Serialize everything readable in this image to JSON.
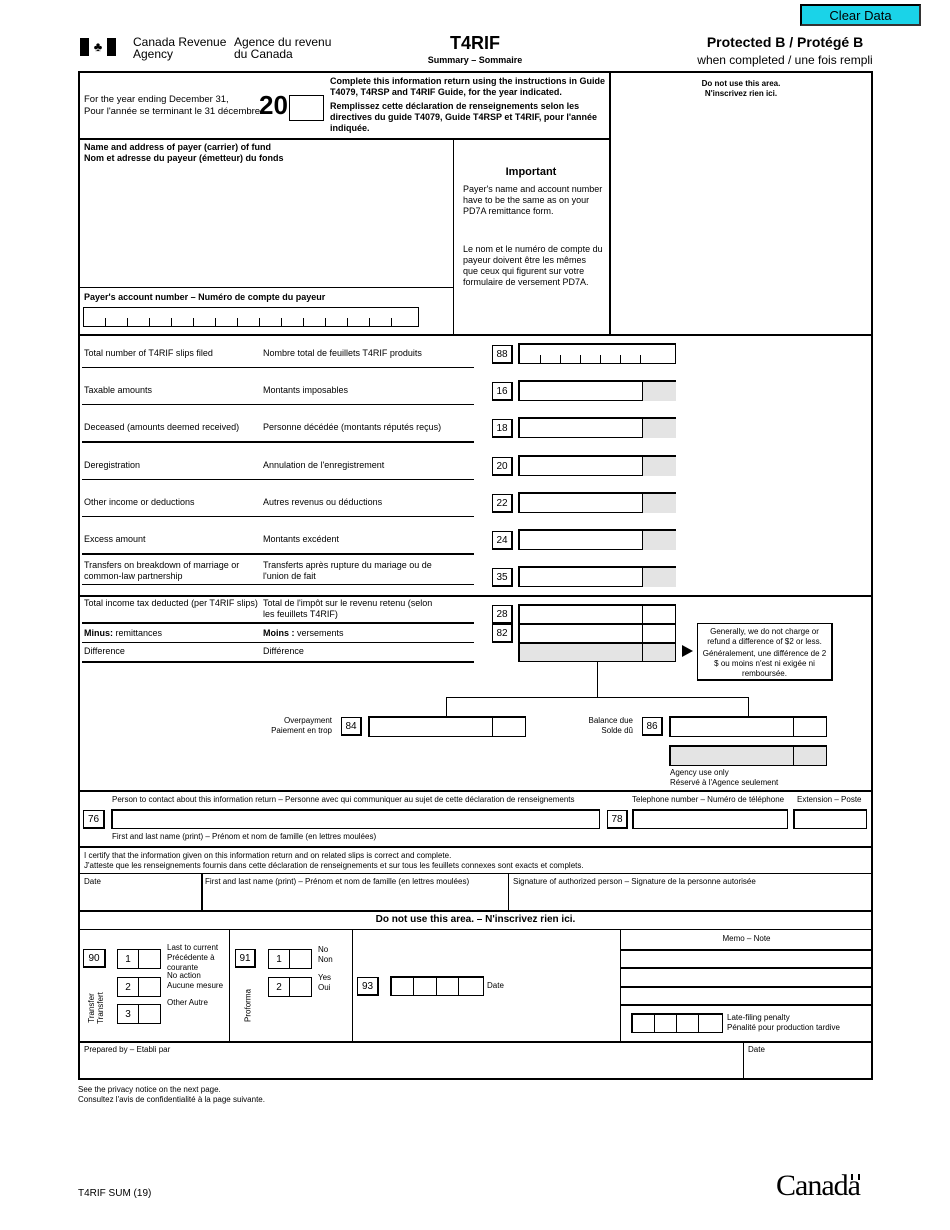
{
  "toolbar": {
    "clear_button": "Clear Data",
    "clear_button_color": "#1ad3e8"
  },
  "header": {
    "agency_en_1": "Canada Revenue",
    "agency_en_2": "Agency",
    "agency_fr_1": "Agence du revenu",
    "agency_fr_2": "du Canada",
    "form_title": "T4RIF",
    "form_subtitle": "Summary – Sommaire",
    "protected": "Protected B / Protégé B",
    "protected_sub": "when completed / une fois rempli"
  },
  "year": {
    "label_en": "For the year ending December 31,",
    "label_fr": "Pour l'année se terminant le 31 décembre",
    "prefix": "20",
    "value": "",
    "instr_en": "Complete this information return using the instructions in Guide T4079, T4RSP and T4RIF Guide, for the year indicated.",
    "instr_fr": "Remplissez cette déclaration de renseignements selon les directives du guide T4079, Guide T4RSP et T4RIF, pour l'année indiquée."
  },
  "do_not_use": {
    "line1": "Do not use this area.",
    "line2": "N'inscrivez rien ici."
  },
  "payer": {
    "label_en": "Name and address of payer (carrier) of fund",
    "label_fr": "Nom et adresse du payeur (émetteur) du fonds",
    "name_address": "",
    "account_label": "Payer's account number – Numéro de compte du payeur",
    "account_value": ""
  },
  "important": {
    "title": "Important",
    "text_en": "Payer's name and account number have to be the same as on your PD7A remittance form.",
    "text_fr": "Le nom et le numéro de compte du payeur doivent être les mêmes que ceux qui figurent sur votre formulaire de versement PD7A."
  },
  "lines": [
    {
      "en": "Total number of T4RIF slips filed",
      "fr": "Nombre total de feuillets T4RIF produits",
      "code": "88",
      "value": ""
    },
    {
      "en": "Taxable amounts",
      "fr": "Montants imposables",
      "code": "16",
      "value": ""
    },
    {
      "en": "Deceased (amounts deemed received)",
      "fr": "Personne décédée (montants réputés reçus)",
      "code": "18",
      "value": ""
    },
    {
      "en": "Deregistration",
      "fr": "Annulation de l'enregistrement",
      "code": "20",
      "value": ""
    },
    {
      "en": "Other income or deductions",
      "fr": "Autres revenus ou déductions",
      "code": "22",
      "value": ""
    },
    {
      "en": "Excess amount",
      "fr": "Montants excédent",
      "code": "24",
      "value": ""
    },
    {
      "en": "Transfers on breakdown of marriage or common-law partnership",
      "fr": "Transferts après rupture du mariage ou de l'union de fait",
      "code": "35",
      "value": ""
    }
  ],
  "tax": {
    "total_en": "Total income tax deducted (per T4RIF slips)",
    "total_fr": "Total de l'impôt sur le revenu retenu (selon les feuillets T4RIF)",
    "total_code": "28",
    "minus_en_bold": "Minus:",
    "minus_en": " remittances",
    "minus_fr_bold": "Moins :",
    "minus_fr": " versements",
    "minus_code": "82",
    "diff_en": "Difference",
    "diff_fr": "Différence",
    "note_en": "Generally, we do not charge or refund a difference of $2 or less.",
    "note_fr": "Généralement, une différence de 2 $ ou moins n'est ni exigée ni remboursée.",
    "overpayment_en": "Overpayment",
    "overpayment_fr": "Paiement en trop",
    "overpayment_code": "84",
    "balance_en": "Balance due",
    "balance_fr": "Solde dû",
    "balance_code": "86",
    "agency_en": "Agency use only",
    "agency_fr": "Réservé à l'Agence seulement"
  },
  "contact": {
    "person_label": "Person to contact about this information return – Personne avec qui communiquer au sujet de cette déclaration de renseignements",
    "person_code": "76",
    "phone_label": "Telephone number – Numéro de téléphone",
    "phone_code": "78",
    "ext_label": "Extension – Poste",
    "name_hint": "First and last name (print) – Prénom et nom de famille (en lettres moulées)"
  },
  "certify": {
    "line_en": "I certify that the information given on this information return and on related slips is correct and complete.",
    "line_fr": "J'atteste que les renseignements fournis dans cette déclaration de renseignements et sur tous les feuillets connexes sont exacts et complets.",
    "date_label": "Date",
    "name_label": "First and last name (print) – Prénom et nom de famille (en lettres moulées)",
    "signature_label": "Signature of authorized person – Signature de la personne autorisée"
  },
  "office": {
    "title": "Do not use this area. – N'inscrivez rien ici.",
    "transfer_label_en": "Transfer",
    "transfer_label_fr": "Transfert",
    "transfer_code": "90",
    "transfer_options": [
      {
        "num": "1",
        "text": "Last to current Précédente à courante"
      },
      {
        "num": "2",
        "text": "No action Aucune mesure"
      },
      {
        "num": "3",
        "text": "Other Autre"
      }
    ],
    "proforma_label": "Proforma",
    "proforma_code": "91",
    "proforma_options": [
      {
        "num": "1",
        "en": "No",
        "fr": "Non"
      },
      {
        "num": "2",
        "en": "Yes",
        "fr": "Oui"
      }
    ],
    "date_code": "93",
    "date_label": "Date",
    "memo_label": "Memo – Note",
    "penalty_en": "Late-filing penalty",
    "penalty_fr": "Pénalité pour production tardive",
    "prepared_label": "Prepared by – Etabli par",
    "prepared_date": "Date"
  },
  "footer": {
    "privacy_en": "See the privacy notice on the next page.",
    "privacy_fr": "Consultez l'avis de confidentialité à la page suivante.",
    "form_code": "T4RIF SUM (19)",
    "wordmark": "Canada"
  }
}
